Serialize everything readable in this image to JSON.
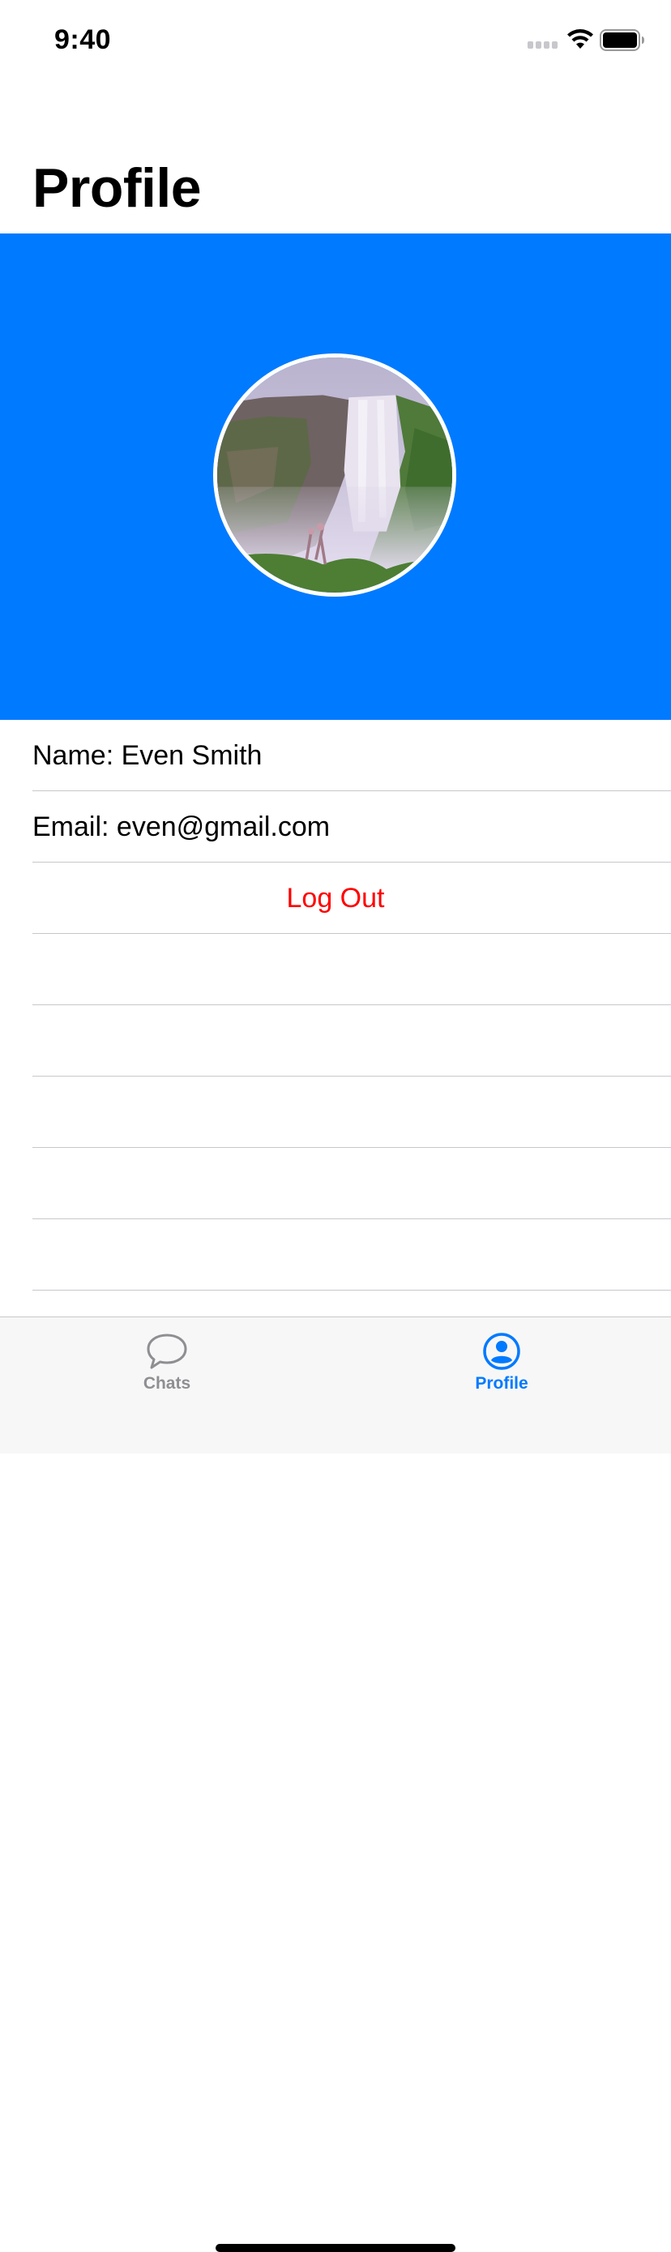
{
  "status_bar": {
    "time": "9:40"
  },
  "page_title": "Profile",
  "colors": {
    "accent": "#007aff",
    "banner": "#007aff",
    "destructive": "#ff0000",
    "tab_inactive": "#8e8e93",
    "separator": "#c8c7cc"
  },
  "profile": {
    "avatar_icon": "waterfall-photo",
    "name_row": "Name: Even Smith",
    "email_row": "Email: even@gmail.com",
    "logout_label": "Log Out"
  },
  "tab_bar": {
    "tabs": [
      {
        "label": "Chats",
        "icon": "chat-bubble-icon",
        "selected": false
      },
      {
        "label": "Profile",
        "icon": "person-circle-icon",
        "selected": true
      }
    ]
  }
}
